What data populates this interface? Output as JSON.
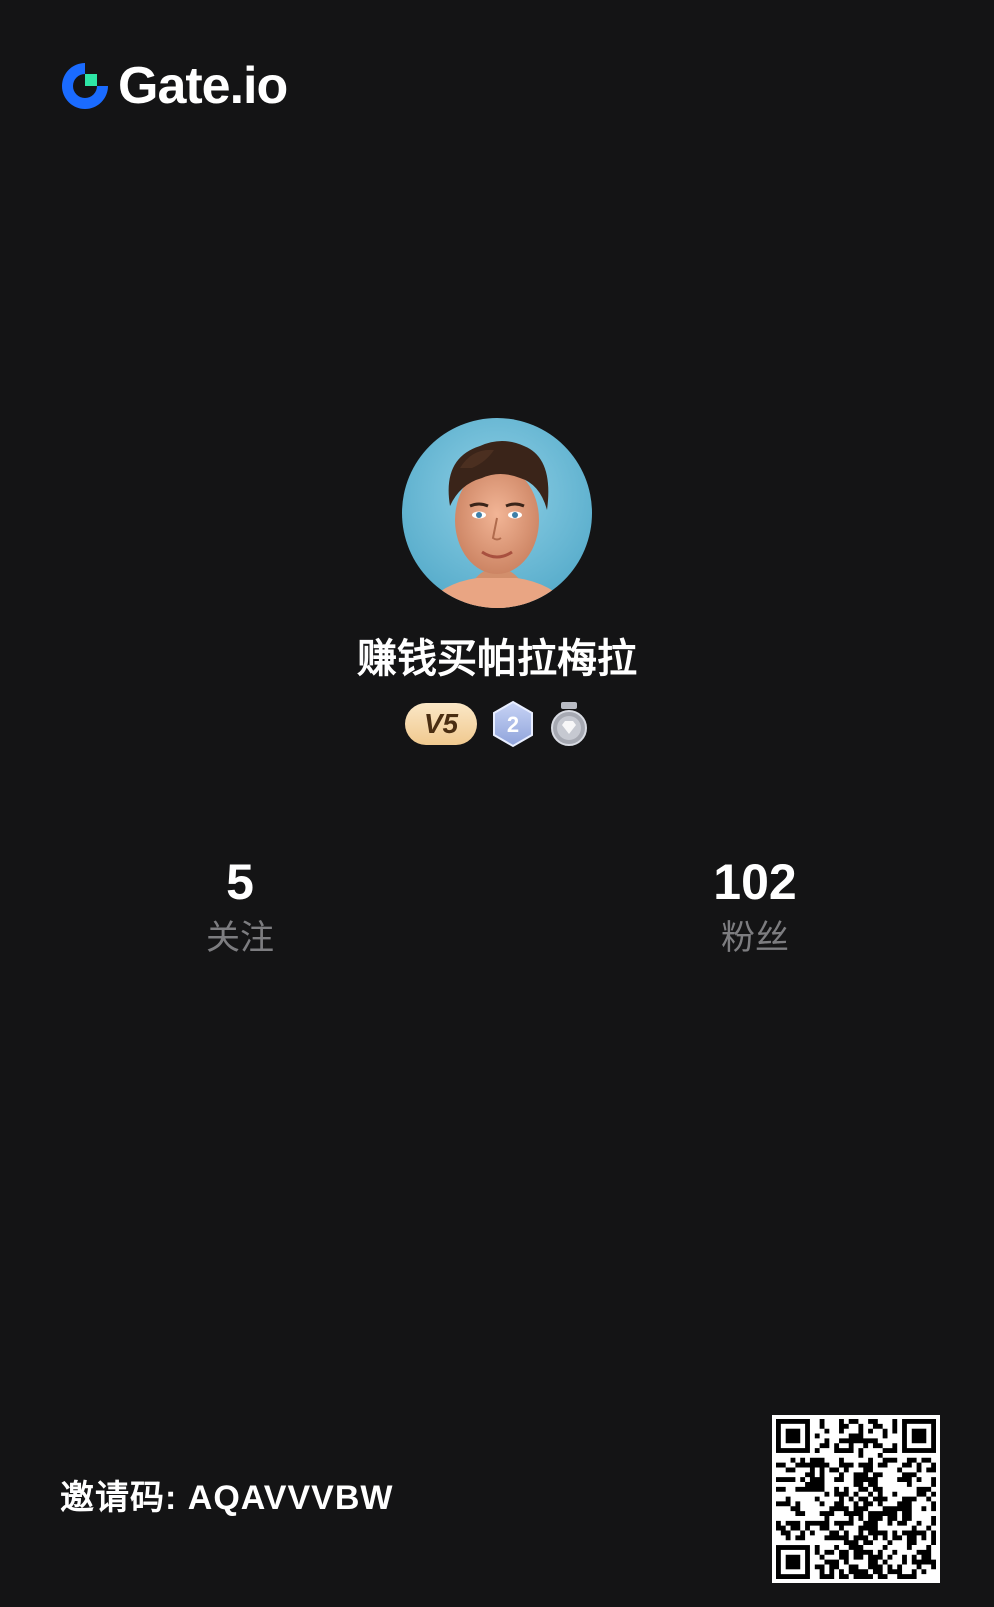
{
  "brand": {
    "name": "Gate.io",
    "logo_icon": "gate-logo-icon",
    "accent_blue": "#1a6bff",
    "accent_green": "#2ee6a6"
  },
  "profile": {
    "avatar_icon": "user-avatar",
    "username": "赚钱买帕拉梅拉",
    "vip_label": "V5",
    "level_badge": "2",
    "medal_icon": "diamond-medal-icon"
  },
  "stats": {
    "following": {
      "value": "5",
      "label": "关注"
    },
    "followers": {
      "value": "102",
      "label": "粉丝"
    }
  },
  "invite": {
    "label": "邀请码: AQAVVVBW",
    "qr_icon": "qr-code"
  },
  "colors": {
    "background": "#141415",
    "muted_text": "#7d7d80",
    "vip_gold": "#f0c98f"
  }
}
